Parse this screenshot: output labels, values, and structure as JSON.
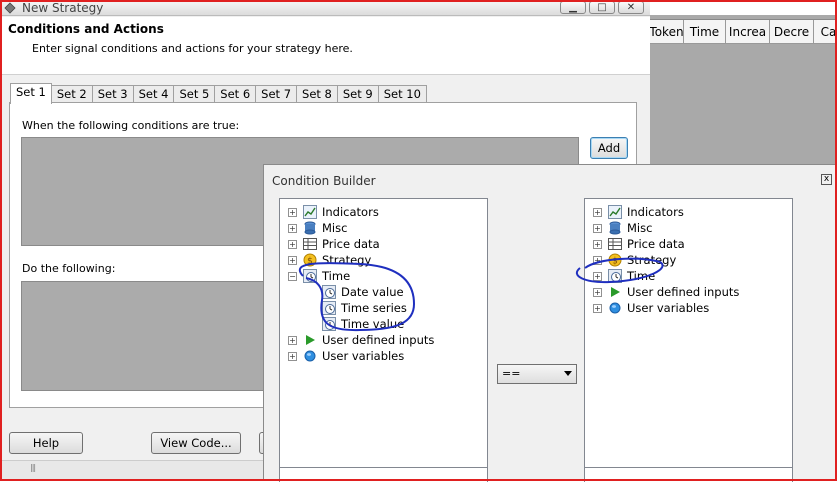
{
  "window": {
    "title": "New Strategy",
    "header_title": "Conditions and Actions",
    "header_subtitle": "Enter signal conditions and actions for your strategy here.",
    "controls": [
      "▁",
      "□",
      "✕"
    ]
  },
  "tabs": [
    "Set 1",
    "Set 2",
    "Set 3",
    "Set 4",
    "Set 5",
    "Set 6",
    "Set 7",
    "Set 8",
    "Set 9",
    "Set 10"
  ],
  "active_tab": "Set 1",
  "conditions_label": "When the following conditions are true:",
  "add_label": "Add",
  "actions_label": "Do the following:",
  "footer": {
    "help_label": "Help",
    "view_code_label": "View Code..."
  },
  "background_columns": [
    "Token",
    "Time",
    "Increa",
    "Decre",
    "Ca"
  ],
  "dialog": {
    "title": "Condition Builder",
    "close": "x",
    "operator": "==",
    "left_tree": [
      {
        "label": "Indicators",
        "icon": "chart-icon",
        "expander": "+"
      },
      {
        "label": "Misc",
        "icon": "database-icon",
        "expander": "+"
      },
      {
        "label": "Price data",
        "icon": "table-icon",
        "expander": "+"
      },
      {
        "label": "Strategy",
        "icon": "coin-icon",
        "expander": "+"
      },
      {
        "label": "Time",
        "icon": "clock-icon",
        "expander": "−"
      },
      {
        "label": "Date value",
        "icon": "clock-icon",
        "expander": ""
      },
      {
        "label": "Time series",
        "icon": "clock-icon",
        "expander": ""
      },
      {
        "label": "Time value",
        "icon": "clock-icon",
        "expander": ""
      },
      {
        "label": "User defined inputs",
        "icon": "play-icon",
        "expander": "+"
      },
      {
        "label": "User variables",
        "icon": "globe-icon",
        "expander": "+"
      }
    ],
    "right_tree": [
      {
        "label": "Indicators",
        "icon": "chart-icon",
        "expander": "+"
      },
      {
        "label": "Misc",
        "icon": "database-icon",
        "expander": "+"
      },
      {
        "label": "Price data",
        "icon": "table-icon",
        "expander": "+"
      },
      {
        "label": "Strategy",
        "icon": "coin-icon",
        "expander": "+"
      },
      {
        "label": "Time",
        "icon": "clock-icon",
        "expander": "+"
      },
      {
        "label": "User defined inputs",
        "icon": "play-icon",
        "expander": "+"
      },
      {
        "label": "User variables",
        "icon": "globe-icon",
        "expander": "+"
      }
    ]
  },
  "colors": {
    "frame": "#e02020",
    "annotation_ink": "#1f2fbf",
    "panel_gray": "#ababab"
  }
}
